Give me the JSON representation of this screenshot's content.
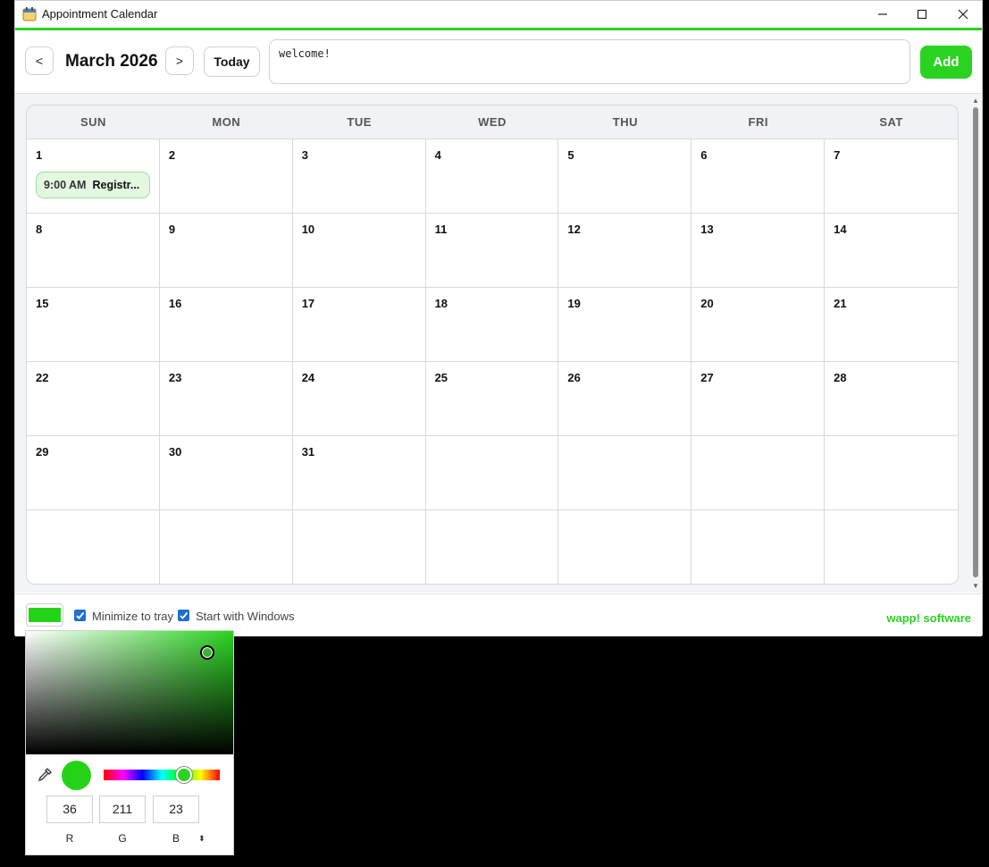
{
  "window": {
    "title": "Appointment Calendar"
  },
  "colors": {
    "accent": "#2bd321",
    "selected": "#24d317",
    "check": "#1f6fd1"
  },
  "toolbar": {
    "prev_label": "<",
    "month_title": "March 2026",
    "next_label": ">",
    "today_label": "Today",
    "entry_value": "welcome!",
    "add_label": "Add"
  },
  "calendar": {
    "days_of_week": [
      "SUN",
      "MON",
      "TUE",
      "WED",
      "THU",
      "FRI",
      "SAT"
    ],
    "cells": [
      "1",
      "2",
      "3",
      "4",
      "5",
      "6",
      "7",
      "8",
      "9",
      "10",
      "11",
      "12",
      "13",
      "14",
      "15",
      "16",
      "17",
      "18",
      "19",
      "20",
      "21",
      "22",
      "23",
      "24",
      "25",
      "26",
      "27",
      "28",
      "29",
      "30",
      "31",
      "",
      "",
      "",
      "",
      "",
      "",
      "",
      "",
      "",
      "",
      ""
    ],
    "events": [
      {
        "day": "1",
        "time": "9:00 AM",
        "title": "Registr..."
      }
    ]
  },
  "footer": {
    "minimize_label": "Minimize to tray",
    "minimize_checked": true,
    "startup_label": "Start with Windows",
    "startup_checked": true,
    "brand": "wapp! software"
  },
  "picker": {
    "r": "36",
    "g": "211",
    "b": "23",
    "r_label": "R",
    "g_label": "G",
    "b_label": "B",
    "mode_toggle": "⌃⌄"
  }
}
